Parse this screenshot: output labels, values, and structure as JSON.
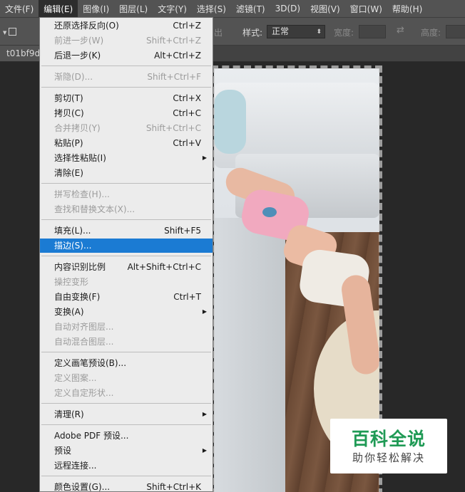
{
  "menubar": {
    "items": [
      "文件(F)",
      "编辑(E)",
      "图像(I)",
      "图层(L)",
      "文字(Y)",
      "选择(S)",
      "滤镜(T)",
      "3D(D)",
      "视图(V)",
      "窗口(W)",
      "帮助(H)"
    ],
    "active_index": 1
  },
  "options": {
    "partial_label": "出",
    "style_label": "样式:",
    "style_value": "正常",
    "width_label": "宽度:",
    "height_label": "高度:"
  },
  "document": {
    "tab_title": "t01bf9d"
  },
  "edit_menu": {
    "undo": {
      "label": "还原选择反向(O)",
      "shortcut": "Ctrl+Z"
    },
    "step_forward": {
      "label": "前进一步(W)",
      "shortcut": "Shift+Ctrl+Z"
    },
    "step_back": {
      "label": "后退一步(K)",
      "shortcut": "Alt+Ctrl+Z"
    },
    "fade": {
      "label": "渐隐(D)...",
      "shortcut": "Shift+Ctrl+F"
    },
    "cut": {
      "label": "剪切(T)",
      "shortcut": "Ctrl+X"
    },
    "copy": {
      "label": "拷贝(C)",
      "shortcut": "Ctrl+C"
    },
    "copy_merged": {
      "label": "合并拷贝(Y)",
      "shortcut": "Shift+Ctrl+C"
    },
    "paste": {
      "label": "粘贴(P)",
      "shortcut": "Ctrl+V"
    },
    "paste_special": {
      "label": "选择性粘贴(I)"
    },
    "clear": {
      "label": "清除(E)"
    },
    "spell_check": {
      "label": "拼写检查(H)..."
    },
    "find_replace": {
      "label": "查找和替换文本(X)..."
    },
    "fill": {
      "label": "填充(L)...",
      "shortcut": "Shift+F5"
    },
    "stroke": {
      "label": "描边(S)..."
    },
    "content_aware_scale": {
      "label": "内容识别比例",
      "shortcut": "Alt+Shift+Ctrl+C"
    },
    "puppet_warp": {
      "label": "操控变形"
    },
    "free_transform": {
      "label": "自由变换(F)",
      "shortcut": "Ctrl+T"
    },
    "transform": {
      "label": "变换(A)"
    },
    "auto_align": {
      "label": "自动对齐图层..."
    },
    "auto_blend": {
      "label": "自动混合图层..."
    },
    "define_brush": {
      "label": "定义画笔预设(B)..."
    },
    "define_pattern": {
      "label": "定义图案..."
    },
    "define_shape": {
      "label": "定义自定形状..."
    },
    "purge": {
      "label": "清理(R)"
    },
    "pdf_presets": {
      "label": "Adobe PDF 预设..."
    },
    "presets": {
      "label": "预设"
    },
    "remote": {
      "label": "远程连接..."
    },
    "color_settings": {
      "label": "颜色设置(G)...",
      "shortcut": "Shift+Ctrl+K"
    }
  },
  "watermark": {
    "title": "百科全说",
    "subtitle": "助你轻松解决"
  },
  "colors": {
    "highlight": "#1b7bd3",
    "menubar": "#535353",
    "watermark_green": "#1f9a55"
  }
}
